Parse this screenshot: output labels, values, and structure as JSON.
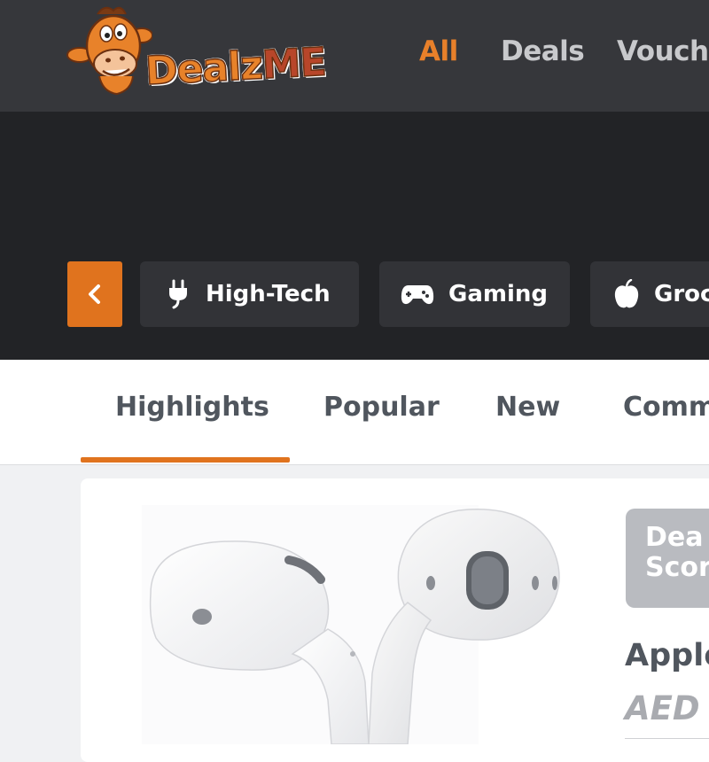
{
  "header": {
    "logo": {
      "text_main": "Dealz",
      "text_accent": "ME"
    },
    "nav": [
      {
        "label": "All",
        "active": true
      },
      {
        "label": "Deals",
        "active": false
      },
      {
        "label": "Vouche",
        "active": false
      }
    ]
  },
  "categories": {
    "prev_icon": "chevron-left-icon",
    "items": [
      {
        "label": "High-Tech",
        "icon": "plug-icon"
      },
      {
        "label": "Gaming",
        "icon": "gamepad-icon"
      },
      {
        "label": "Groc",
        "icon": "apple-icon"
      }
    ]
  },
  "tabs": [
    {
      "label": "Highlights",
      "active": true
    },
    {
      "label": "Popular",
      "active": false
    },
    {
      "label": "New",
      "active": false
    },
    {
      "label": "Comm",
      "active": false
    }
  ],
  "deal": {
    "score_label": "Deal Score",
    "score_line1": "Dea",
    "score_line2": "Scor",
    "title": "Apple",
    "price": "AED",
    "image_subject": "earbuds-image"
  },
  "colors": {
    "accent": "#e0731e",
    "header_bg": "#36373b",
    "band_bg": "#222326",
    "chip_bg": "#323337"
  }
}
